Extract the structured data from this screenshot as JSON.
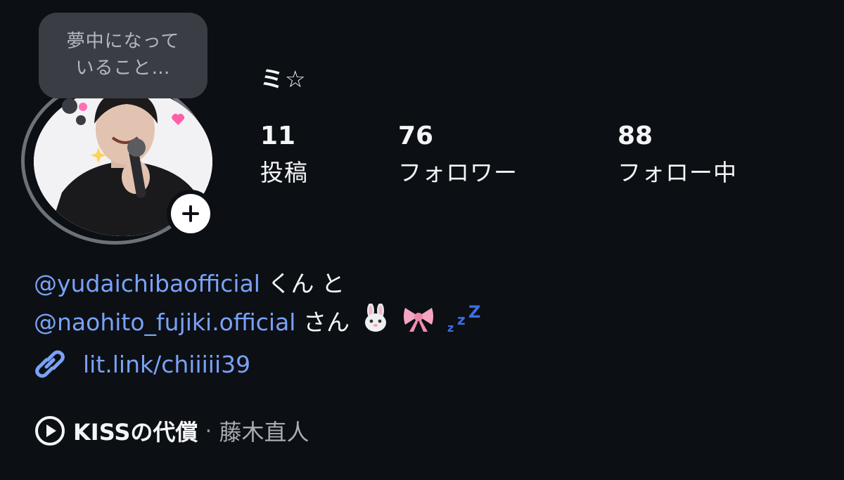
{
  "note": {
    "line1": "夢中になって",
    "line2": "いること…"
  },
  "profile": {
    "display_name": "ミ☆",
    "stats": [
      {
        "value": "11",
        "label": "投稿"
      },
      {
        "value": "76",
        "label": "フォロワー"
      },
      {
        "value": "88",
        "label": "フォロー中"
      }
    ]
  },
  "bio": {
    "mention1": "@yudaichibaofficial",
    "text1": " くん と",
    "mention2": "@naohito_fujiki.official",
    "text2": " さん",
    "emojis": [
      "rabbit-face",
      "ribbon",
      "zzz"
    ]
  },
  "link": {
    "url_text": "lit.link/chiiiii39"
  },
  "music": {
    "title": "KISSの代償",
    "separator": "·",
    "artist": "藤木直人"
  },
  "colors": {
    "background": "#0c0f14",
    "link": "#7aa2f7",
    "note_bubble": "#3a3e44"
  }
}
